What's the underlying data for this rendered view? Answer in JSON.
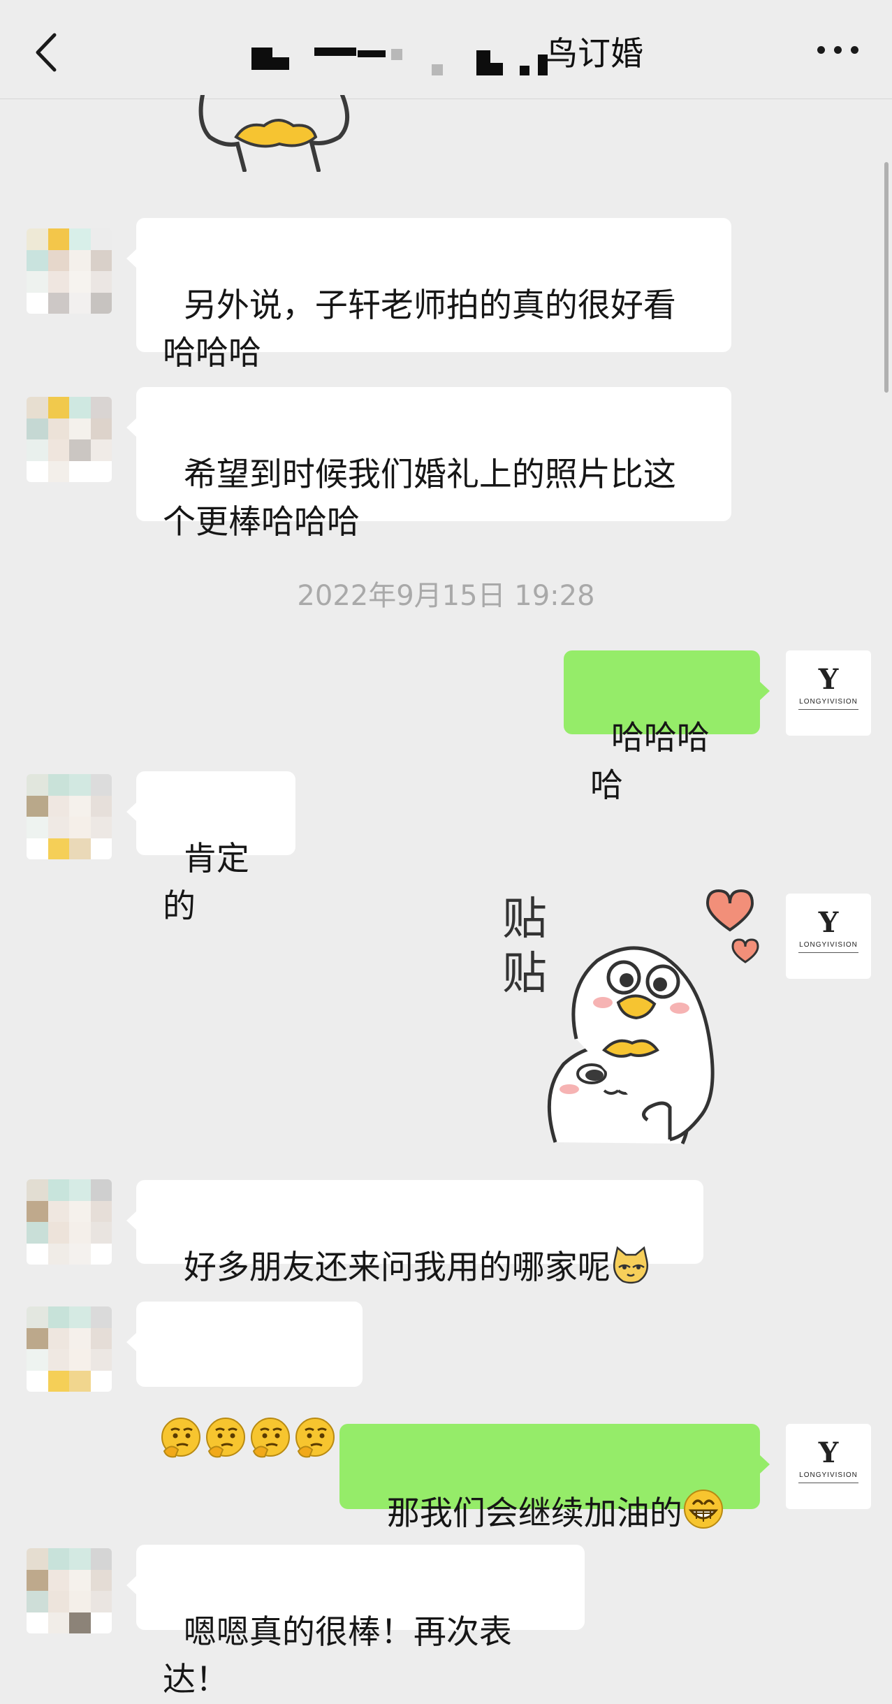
{
  "header": {
    "title_suffix": "鸟订婚",
    "back_icon": "chevron-left-icon",
    "more_icon": "ellipsis-icon"
  },
  "colors": {
    "background": "#ededed",
    "incoming_bubble": "#ffffff",
    "outgoing_bubble": "#95ec69",
    "timestamp_text": "#a9a9a9"
  },
  "timestamp": "2022年9月15日 19:28",
  "messages": [
    {
      "id": "m1",
      "side": "in",
      "text": "另外说，子轩老师拍的真的很好看哈哈哈"
    },
    {
      "id": "m2",
      "side": "in",
      "text": "希望到时候我们婚礼上的照片比这个更棒哈哈哈"
    },
    {
      "id": "m3",
      "side": "out",
      "text": "哈哈哈哈"
    },
    {
      "id": "m4",
      "side": "in",
      "text": "肯定的"
    },
    {
      "id": "m5",
      "side": "out",
      "sticker": "duck-hug-sticker",
      "sticker_text": "贴贴"
    },
    {
      "id": "m6",
      "side": "in",
      "text": "好多朋友还来问我用的哪家呢",
      "emoji": "cat-face-emoji"
    },
    {
      "id": "m7",
      "side": "in",
      "emoji": "thinking-face-emoji",
      "emoji_count": 4
    },
    {
      "id": "m8",
      "side": "out",
      "text": "那我们会继续加油的",
      "emoji": "grinning-face-emoji"
    },
    {
      "id": "m9",
      "side": "in",
      "text": "嗯嗯真的很棒！再次表达！"
    }
  ],
  "brand_avatar": {
    "mark": "Y",
    "name": "LONGYIVISION"
  }
}
